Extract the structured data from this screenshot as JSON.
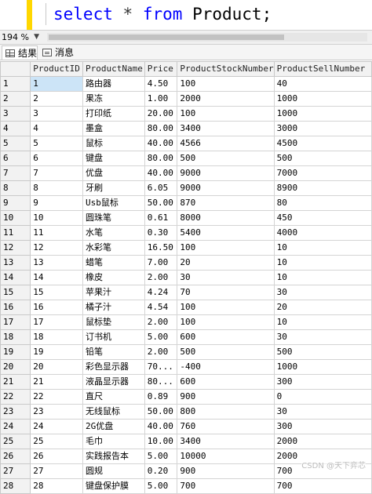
{
  "editor": {
    "query": {
      "kw1": "select",
      "star": "*",
      "kw2": "from",
      "table": "Product;"
    }
  },
  "zoom": {
    "value": "194 %"
  },
  "tabs": {
    "results": "结果",
    "messages": "消息"
  },
  "grid": {
    "headers": [
      "ProductID",
      "ProductName",
      "Price",
      "ProductStockNumber",
      "ProductSellNumber"
    ],
    "rows": [
      [
        "1",
        "1",
        "路由器",
        "4.50",
        "100",
        "40"
      ],
      [
        "2",
        "2",
        "果冻",
        "1.00",
        "2000",
        "1000"
      ],
      [
        "3",
        "3",
        "打印纸",
        "20.00",
        "100",
        "1000"
      ],
      [
        "4",
        "4",
        "墨盒",
        "80.00",
        "3400",
        "3000"
      ],
      [
        "5",
        "5",
        "鼠标",
        "40.00",
        "4566",
        "4500"
      ],
      [
        "6",
        "6",
        "键盘",
        "80.00",
        "500",
        "500"
      ],
      [
        "7",
        "7",
        "优盘",
        "40.00",
        "9000",
        "7000"
      ],
      [
        "8",
        "8",
        "牙刷",
        "6.05",
        "9000",
        "8900"
      ],
      [
        "9",
        "9",
        "Usb鼠标",
        "50.00",
        "870",
        "80"
      ],
      [
        "10",
        "10",
        "圆珠笔",
        "0.61",
        "8000",
        "450"
      ],
      [
        "11",
        "11",
        "水笔",
        "0.30",
        "5400",
        "4000"
      ],
      [
        "12",
        "12",
        "水彩笔",
        "16.50",
        "100",
        "10"
      ],
      [
        "13",
        "13",
        "蜡笔",
        "7.00",
        "20",
        "10"
      ],
      [
        "14",
        "14",
        "橡皮",
        "2.00",
        "30",
        "10"
      ],
      [
        "15",
        "15",
        "苹果汁",
        "4.24",
        "70",
        "30"
      ],
      [
        "16",
        "16",
        "橘子汁",
        "4.54",
        "100",
        "20"
      ],
      [
        "17",
        "17",
        "鼠标垫",
        "2.00",
        "100",
        "10"
      ],
      [
        "18",
        "18",
        "订书机",
        "5.00",
        "600",
        "30"
      ],
      [
        "19",
        "19",
        "铅笔",
        "2.00",
        "500",
        "500"
      ],
      [
        "20",
        "20",
        "彩色显示器",
        "70...",
        "-400",
        "1000"
      ],
      [
        "21",
        "21",
        "液晶显示器",
        "80...",
        "600",
        "300"
      ],
      [
        "22",
        "22",
        "直尺",
        "0.89",
        "900",
        "0"
      ],
      [
        "23",
        "23",
        "无线鼠标",
        "50.00",
        "800",
        "30"
      ],
      [
        "24",
        "24",
        "2G优盘",
        "40.00",
        "760",
        "300"
      ],
      [
        "25",
        "25",
        "毛巾",
        "10.00",
        "3400",
        "2000"
      ],
      [
        "26",
        "26",
        "实践报告本",
        "5.00",
        "10000",
        "2000"
      ],
      [
        "27",
        "27",
        "圆规",
        "0.20",
        "900",
        "700"
      ],
      [
        "28",
        "28",
        "键盘保护膜",
        "5.00",
        "700",
        "700"
      ]
    ]
  },
  "watermark": "CSDN @天下弈芯"
}
